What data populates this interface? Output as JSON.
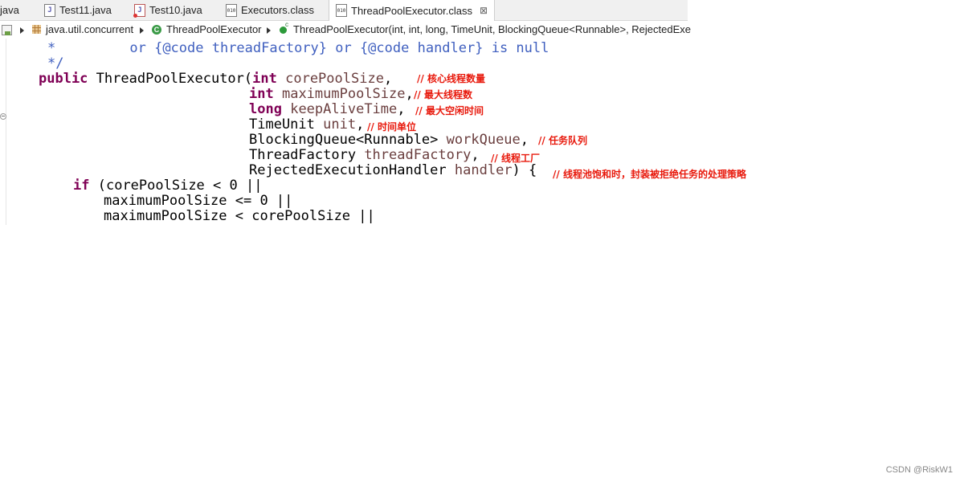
{
  "tabs": [
    {
      "label": "java",
      "icon": "none"
    },
    {
      "label": "Test11.java",
      "icon": "java-file-icon"
    },
    {
      "label": "Test10.java",
      "icon": "java-file-error-icon"
    },
    {
      "label": "Executors.class",
      "icon": "class-file-icon"
    },
    {
      "label": "ThreadPoolExecutor.class",
      "icon": "class-file-icon",
      "active": true,
      "close": "⊠"
    }
  ],
  "breadcrumb": {
    "package": "java.util.concurrent",
    "class": "ThreadPoolExecutor",
    "constructor": "ThreadPoolExecutor(int, int, long, TimeUnit, BlockingQueue<Runnable>, RejectedExe"
  },
  "code": {
    "l1_star": "*",
    "l1_text": "or {@code threadFactory} or {@code handler} is null",
    "l2": "*/",
    "public": "public",
    "ctor_name": "ThreadPoolExecutor(",
    "int": "int",
    "long": "long",
    "p1": "corePoolSize",
    "p2": "maximumPoolSize",
    "p3": "keepAliveTime",
    "p4_type": "TimeUnit",
    "p4": "unit",
    "p5_type": "BlockingQueue<Runnable>",
    "p5": "workQueue",
    "p6_type": "ThreadFactory",
    "p6": "threadFactory",
    "p7_type": "RejectedExecutionHandler",
    "p7": "handler",
    "comma": ",",
    "close_brace": ") {",
    "if": "if",
    "c1": "(corePoolSize < 0 ||",
    "c2": "maximumPoolSize <= 0 ||",
    "c3": "maximumPoolSize < corePoolSize ||"
  },
  "annotations": {
    "a1": "// 核心线程数量",
    "a2": "// 最大线程数",
    "a3": "// 最大空闲时间",
    "a4": "// 时间单位",
    "a5": "// 任务队列",
    "a6": "// 线程工厂",
    "a7": "// 线程池饱和时，封装被拒绝任务的处理策略"
  },
  "watermark": "CSDN @RiskW1",
  "colors": {
    "keyword": "#7f0055",
    "javadoc": "#3f5fbf",
    "parameter": "#6a3e3e",
    "annotation": "#e8190c"
  }
}
